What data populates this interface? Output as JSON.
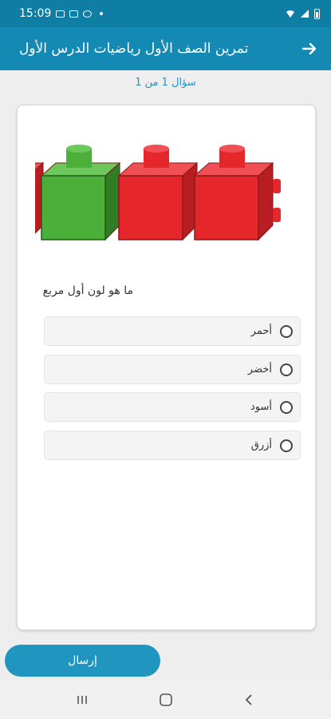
{
  "status_bar": {
    "time": "15:09"
  },
  "app_bar": {
    "title": "تمرين الصف الأول رياضيات الدرس الأول"
  },
  "quiz": {
    "counter": "سؤال 1 من 1",
    "question": "ما هو لون أول مربع",
    "options": [
      {
        "label": "أحمر",
        "selected": false
      },
      {
        "label": "أخضر",
        "selected": false
      },
      {
        "label": "أسود",
        "selected": false
      },
      {
        "label": "أزرق",
        "selected": false
      }
    ],
    "image": {
      "blocks": [
        "red",
        "green",
        "red",
        "red"
      ],
      "colors": {
        "red": "#e5262b",
        "green": "#4caf3a"
      }
    }
  },
  "submit_label": "إرسال",
  "colors": {
    "app_bar": "#1489b3",
    "status_bar": "#0f7ea5",
    "accent": "#1f95c0"
  }
}
